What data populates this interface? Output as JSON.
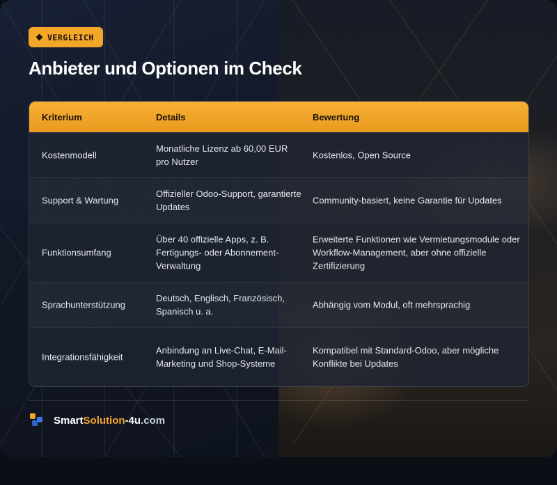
{
  "tag": {
    "label": "VERGLEICH",
    "icon": "diamond-icon"
  },
  "title": "Anbieter und Optionen im Check",
  "table": {
    "headers": [
      "Kriterium",
      "Details",
      "Bewertung"
    ],
    "rows": [
      {
        "kriterium": "Kostenmodell",
        "details": "Monatliche Lizenz ab 60,00 EUR pro Nutzer",
        "bewertung": "Kostenlos, Open Source"
      },
      {
        "kriterium": "Support & Wartung",
        "details": "Offizieller Odoo-Support, garantierte Updates",
        "bewertung": "Community-basiert, keine Garantie für Updates"
      },
      {
        "kriterium": "Funktionsumfang",
        "details": "Über 40 offizielle Apps, z. B. Fertigungs- oder Abonnement-Verwaltung",
        "bewertung": "Erweiterte Funktionen wie Vermietungsmodule oder Workflow-Management, aber ohne offizielle Zertifizierung"
      },
      {
        "kriterium": "Sprachunterstützung",
        "details": "Deutsch, Englisch, Französisch, Spanisch u. a.",
        "bewertung": "Abhängig vom Modul, oft mehrsprachig"
      },
      {
        "kriterium": "Integrationsfähigkeit",
        "details": "Anbindung an Live-Chat, E-Mail-Marketing und Shop-Systeme",
        "bewertung": "Kompatibel mit Standard-Odoo, aber mögliche Konflikte bei Updates"
      }
    ]
  },
  "brand": {
    "part1": "Smart",
    "part2": "Solution",
    "part3": "-4u",
    "part4": ".com"
  },
  "colors": {
    "accent": "#f4a629",
    "background": "#121826"
  }
}
